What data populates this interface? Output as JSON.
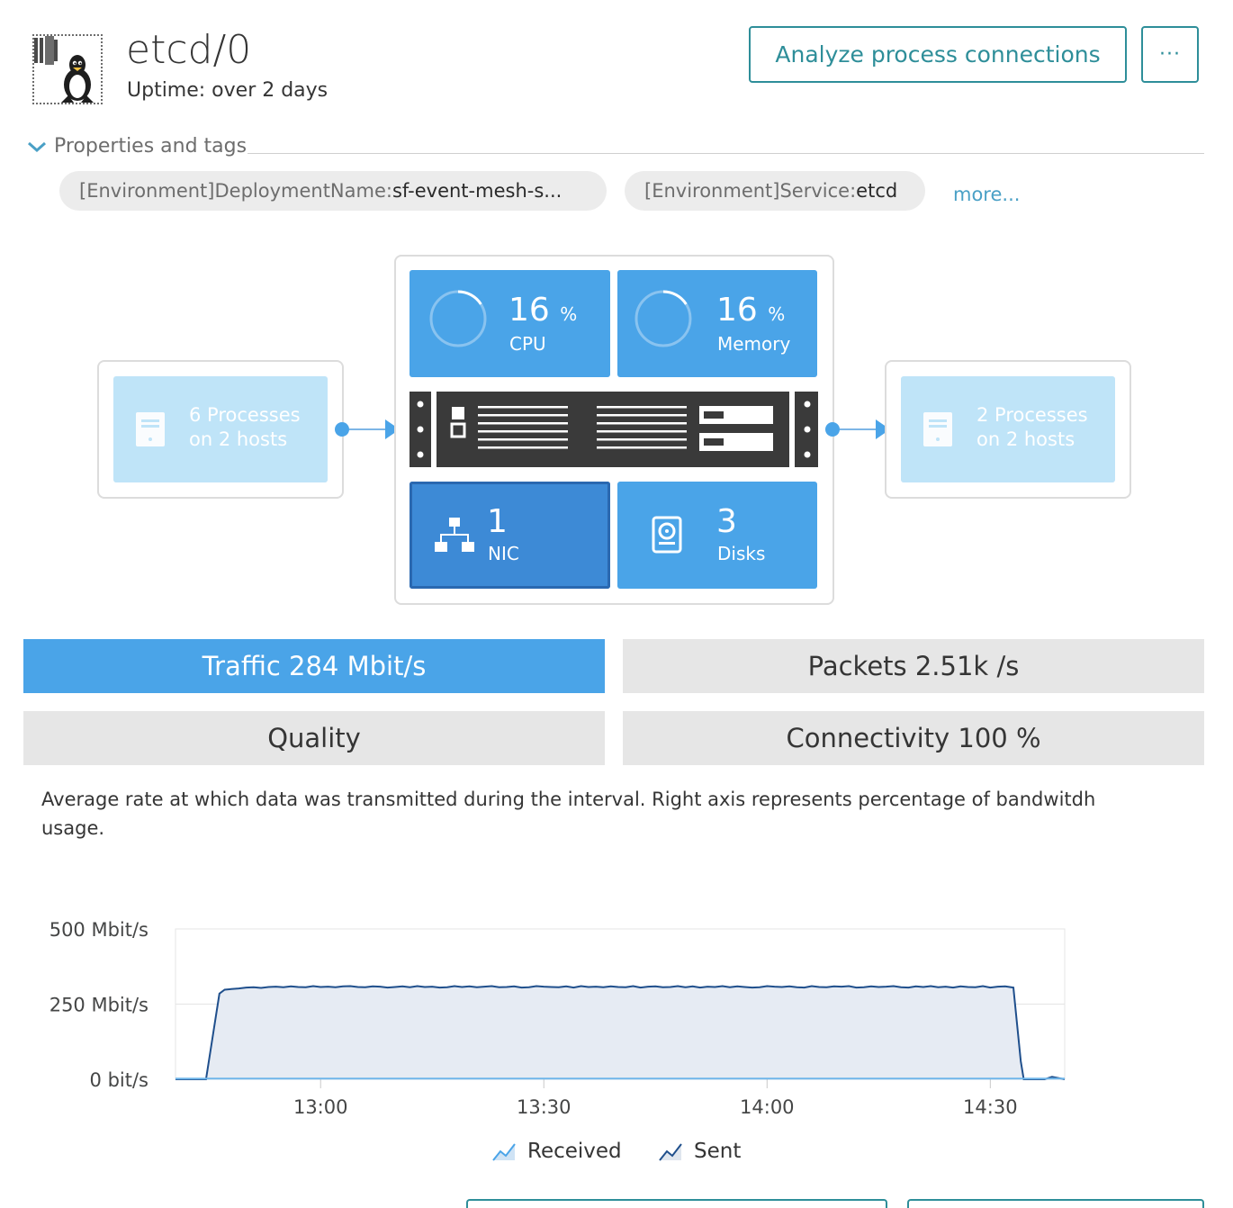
{
  "header": {
    "title": "etcd/0",
    "uptime": "Uptime: over 2 days",
    "analyze_label": "Analyze process connections",
    "more_label": "···"
  },
  "properties": {
    "label": "Properties and tags",
    "tags": [
      {
        "key": "[Environment]DeploymentName: ",
        "value": "sf-event-mesh-s..."
      },
      {
        "key": "[Environment]Service: ",
        "value": "etcd"
      }
    ],
    "more_link": "more..."
  },
  "topology": {
    "callers": {
      "line1": "6 Processes",
      "line2": "on 2 hosts"
    },
    "callees": {
      "line1": "2 Processes",
      "line2": "on 2 hosts"
    },
    "cpu": {
      "value": "16",
      "unit": "%",
      "label": "CPU",
      "fraction": 0.16
    },
    "memory": {
      "value": "16",
      "unit": "%",
      "label": "Memory",
      "fraction": 0.16
    },
    "nic": {
      "value": "1",
      "label": "NIC"
    },
    "disks": {
      "value": "3",
      "label": "Disks"
    }
  },
  "metrics": {
    "traffic": "Traffic 284 Mbit/s",
    "packets": "Packets 2.51k /s",
    "quality": "Quality",
    "connectivity": "Connectivity 100 %"
  },
  "description": "Average rate at which data was transmitted during the interval. Right axis represents percentage of bandwitdh usage.",
  "colors": {
    "accent": "#4aa4e8",
    "teal": "#2e8e99",
    "area_fill": "#e6ebf3",
    "received_line": "#1f4f8c",
    "sent_line": "#6fb6ea"
  },
  "chart_data": {
    "type": "area",
    "y_tick_labels": [
      "500 Mbit/s",
      "250 Mbit/s",
      "0 bit/s"
    ],
    "y_ticks": [
      500,
      250,
      0
    ],
    "ylim": [
      0,
      500
    ],
    "x_tick_labels": [
      "13:00",
      "13:30",
      "14:00",
      "14:30"
    ],
    "x_ticks": [
      780,
      810,
      840,
      870
    ],
    "xlim": [
      760.5,
      880
    ],
    "series": [
      {
        "name": "Received",
        "x": [
          760.5,
          764.6,
          766.4,
          767.1,
          768,
          769,
          770,
          771,
          772,
          773,
          774,
          775,
          776,
          777,
          778,
          779,
          780,
          781,
          782,
          783,
          784,
          785,
          786,
          787,
          788,
          789,
          790,
          791,
          792,
          793,
          794,
          795,
          796,
          797,
          798,
          799,
          800,
          801,
          802,
          803,
          804,
          805,
          806,
          807,
          808,
          809,
          810,
          811,
          812,
          813,
          814,
          815,
          816,
          817,
          818,
          819,
          820,
          821,
          822,
          823,
          824,
          825,
          826,
          827,
          828,
          829,
          830,
          831,
          832,
          833,
          834,
          835,
          836,
          837,
          838,
          839,
          840,
          841,
          842,
          843,
          844,
          845,
          846,
          847,
          848,
          849,
          850,
          851,
          852,
          853,
          854,
          855,
          856,
          857,
          858,
          859,
          860,
          861,
          862,
          863,
          864,
          865,
          866,
          867,
          868,
          869,
          870,
          871,
          872,
          872.6,
          873.1,
          874.1,
          874.5,
          876,
          877.3,
          878.3,
          880
        ],
        "y": [
          0,
          0,
          285,
          298,
          300,
          302,
          305,
          306,
          304,
          307,
          308,
          306,
          309,
          307,
          306,
          310,
          307,
          308,
          306,
          309,
          310,
          307,
          306,
          309,
          308,
          305,
          307,
          309,
          306,
          310,
          307,
          308,
          305,
          306,
          310,
          307,
          309,
          306,
          308,
          310,
          306,
          307,
          309,
          305,
          306,
          310,
          308,
          307,
          306,
          309,
          305,
          310,
          307,
          308,
          306,
          309,
          307,
          306,
          310,
          305,
          308,
          309,
          306,
          307,
          310,
          306,
          309,
          305,
          308,
          307,
          310,
          306,
          309,
          307,
          305,
          306,
          310,
          308,
          307,
          309,
          306,
          305,
          310,
          307,
          306,
          309,
          308,
          310,
          305,
          306,
          309,
          307,
          308,
          310,
          306,
          305,
          309,
          307,
          310,
          306,
          308,
          305,
          309,
          307,
          306,
          310,
          305,
          308,
          309,
          307,
          305,
          60,
          0,
          0,
          0,
          8,
          0
        ]
      },
      {
        "name": "Sent",
        "x": [
          760.5,
          880
        ],
        "y": [
          2,
          2
        ]
      }
    ]
  },
  "legend": {
    "received": "Received",
    "sent": "Sent"
  }
}
